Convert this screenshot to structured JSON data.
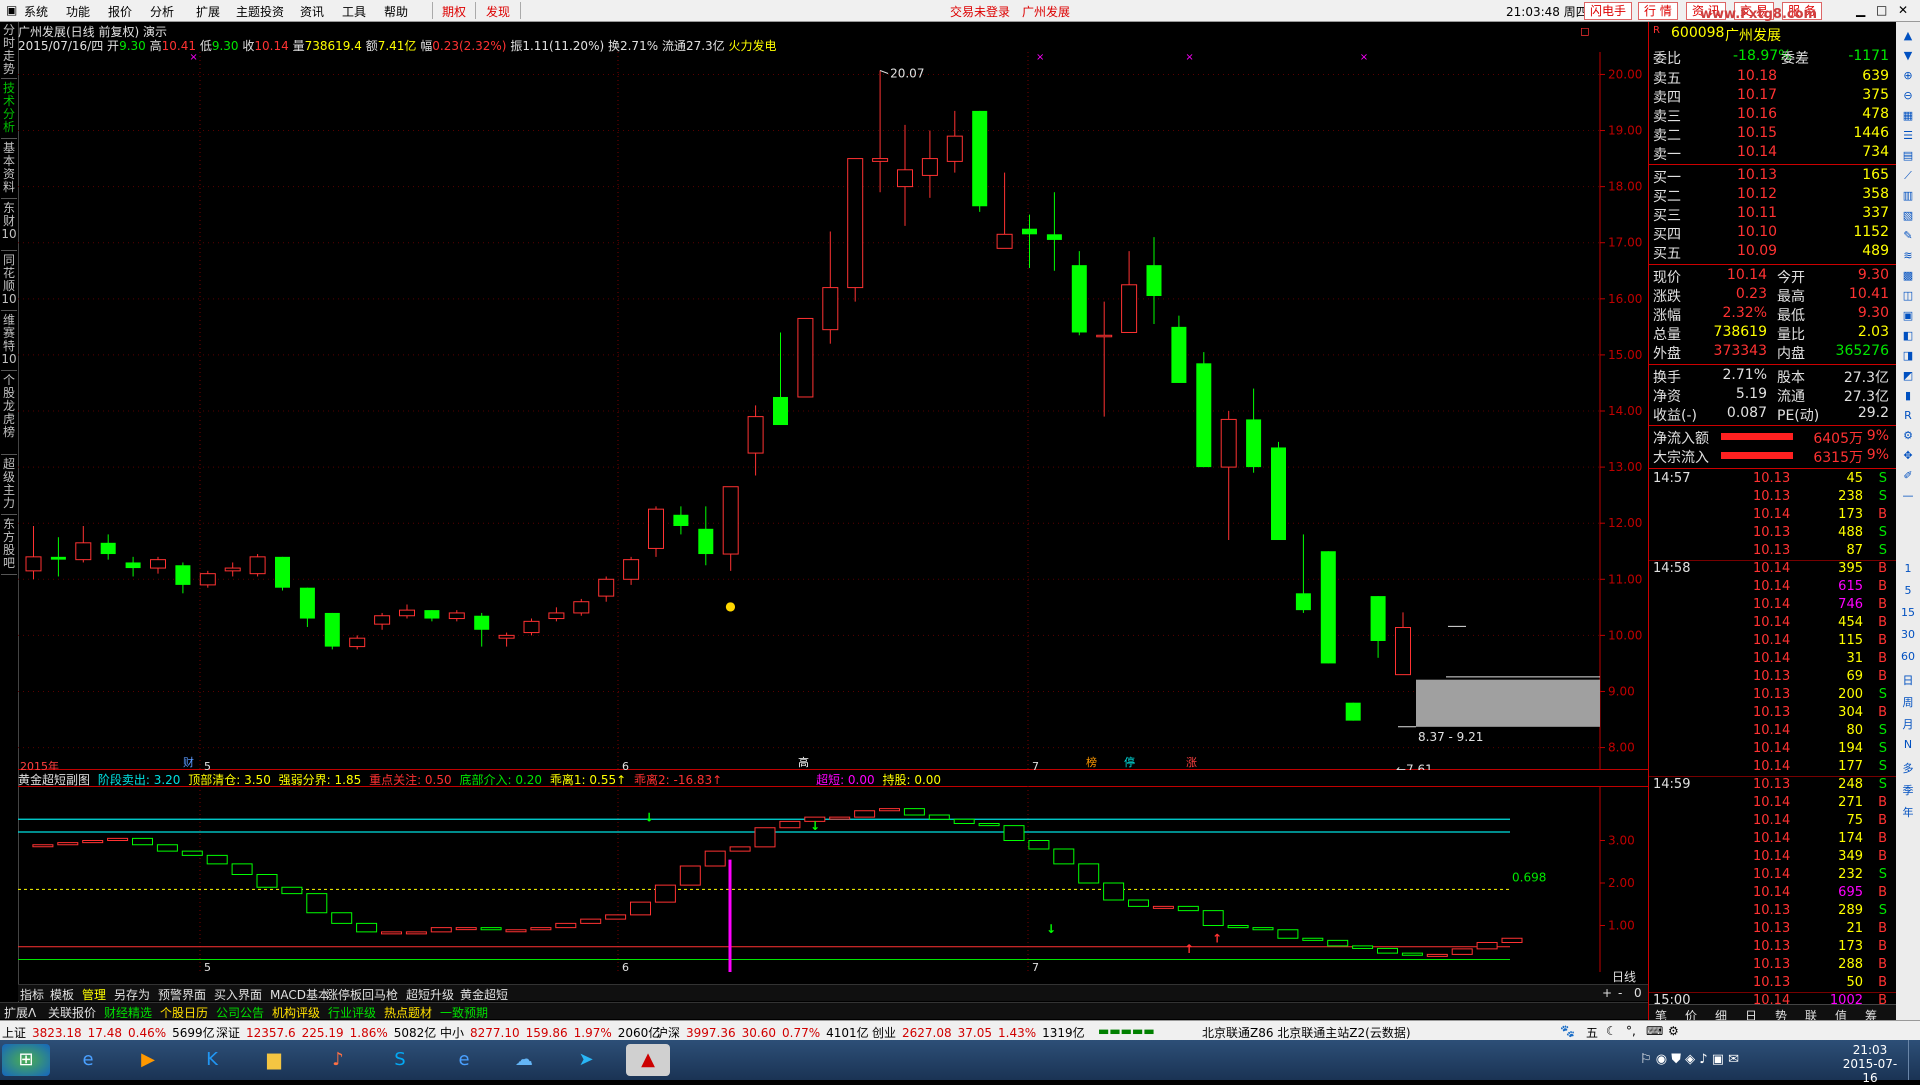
{
  "menu": {
    "items": [
      "系统",
      "功能",
      "报价",
      "分析",
      "扩展",
      "主题投资",
      "资讯",
      "工具",
      "帮助"
    ],
    "tags": [
      "期权",
      "发现"
    ],
    "center_notice": "交易未登录",
    "center_stock": "广州发展",
    "clock": "21:03:48 周四",
    "right_buttons": [
      "闪电手",
      "行",
      "情",
      "资",
      "讯",
      "交",
      "易",
      "服",
      "务"
    ],
    "watermark": "www.Fxtg8.com"
  },
  "left_tabs": [
    "分时走势",
    "技术分析",
    "基本资料",
    "东财10",
    "同花顺10",
    "维赛特10",
    "个股龙虎榜",
    "超级主力",
    "东方股吧"
  ],
  "chart_header": {
    "line1": "广州发展(日线 前复权) 演示",
    "date": "2015/07/16/四",
    "open_label": "开",
    "open": "9.30",
    "high_label": "高",
    "high": "10.41",
    "low_label": "低",
    "low": "9.30",
    "close_label": "收",
    "close": "10.14",
    "vol_label": "量",
    "vol": "738619.4",
    "amt_label": "额",
    "amt": "7.41亿",
    "chg_label": "幅",
    "chg": "0.23(2.32%)",
    "amp": "振1.11(11.20%)",
    "turnover": "换2.71%",
    "float": "流通27.3亿",
    "concept": "火力发电"
  },
  "chart_data": [
    {
      "type": "candlestick",
      "title": "广州发展(日线 前复权) 演示",
      "ylim": [
        7.6,
        20.4
      ],
      "y_ticks": [
        "20.00",
        "19.00",
        "18.00",
        "17.00",
        "16.00",
        "15.00",
        "14.00",
        "13.00",
        "12.00",
        "11.00",
        "10.00",
        "9.00",
        "8.00"
      ],
      "x_labels": [
        "2015年",
        "5",
        "6",
        "7"
      ],
      "annotations": [
        "20.07",
        "7.61",
        "8.37 - 9.21"
      ],
      "candles": [
        {
          "o": 11.15,
          "h": 11.95,
          "l": 11.0,
          "c": 11.4
        },
        {
          "o": 11.4,
          "h": 11.75,
          "l": 11.05,
          "c": 11.35
        },
        {
          "o": 11.35,
          "h": 11.95,
          "l": 11.3,
          "c": 11.65
        },
        {
          "o": 11.65,
          "h": 11.8,
          "l": 11.35,
          "c": 11.45
        },
        {
          "o": 11.3,
          "h": 11.4,
          "l": 11.05,
          "c": 11.2
        },
        {
          "o": 11.2,
          "h": 11.4,
          "l": 11.1,
          "c": 11.35
        },
        {
          "o": 11.25,
          "h": 11.3,
          "l": 10.75,
          "c": 10.9
        },
        {
          "o": 10.9,
          "h": 11.15,
          "l": 10.85,
          "c": 11.1
        },
        {
          "o": 11.15,
          "h": 11.3,
          "l": 11.05,
          "c": 11.2
        },
        {
          "o": 11.1,
          "h": 11.45,
          "l": 11.05,
          "c": 11.4
        },
        {
          "o": 11.4,
          "h": 11.4,
          "l": 10.8,
          "c": 10.85
        },
        {
          "o": 10.85,
          "h": 10.85,
          "l": 10.15,
          "c": 10.3
        },
        {
          "o": 10.4,
          "h": 10.4,
          "l": 9.75,
          "c": 9.8
        },
        {
          "o": 9.8,
          "h": 10.0,
          "l": 9.75,
          "c": 9.95
        },
        {
          "o": 10.2,
          "h": 10.4,
          "l": 10.1,
          "c": 10.35
        },
        {
          "o": 10.35,
          "h": 10.55,
          "l": 10.3,
          "c": 10.45
        },
        {
          "o": 10.45,
          "h": 10.45,
          "l": 10.25,
          "c": 10.3
        },
        {
          "o": 10.3,
          "h": 10.45,
          "l": 10.25,
          "c": 10.4
        },
        {
          "o": 10.35,
          "h": 10.4,
          "l": 9.8,
          "c": 10.1
        },
        {
          "o": 9.95,
          "h": 10.05,
          "l": 9.8,
          "c": 10.0
        },
        {
          "o": 10.05,
          "h": 10.3,
          "l": 10.0,
          "c": 10.25
        },
        {
          "o": 10.3,
          "h": 10.5,
          "l": 10.25,
          "c": 10.4
        },
        {
          "o": 10.4,
          "h": 10.65,
          "l": 10.35,
          "c": 10.6
        },
        {
          "o": 10.7,
          "h": 11.05,
          "l": 10.6,
          "c": 11.0
        },
        {
          "o": 11.0,
          "h": 11.4,
          "l": 10.9,
          "c": 11.35
        },
        {
          "o": 11.55,
          "h": 12.3,
          "l": 11.4,
          "c": 12.25
        },
        {
          "o": 12.15,
          "h": 12.3,
          "l": 11.8,
          "c": 11.95
        },
        {
          "o": 11.9,
          "h": 12.3,
          "l": 11.25,
          "c": 11.45
        },
        {
          "o": 11.45,
          "h": 12.6,
          "l": 11.15,
          "c": 12.65
        },
        {
          "o": 13.25,
          "h": 14.1,
          "l": 12.85,
          "c": 13.9
        },
        {
          "o": 14.25,
          "h": 15.4,
          "l": 13.75,
          "c": 13.75
        },
        {
          "o": 14.25,
          "h": 15.65,
          "l": 14.25,
          "c": 15.65
        },
        {
          "o": 15.45,
          "h": 17.2,
          "l": 15.2,
          "c": 16.2
        },
        {
          "o": 16.2,
          "h": 18.5,
          "l": 15.95,
          "c": 18.5
        },
        {
          "o": 18.45,
          "h": 20.07,
          "l": 17.9,
          "c": 18.5
        },
        {
          "o": 18.0,
          "h": 19.1,
          "l": 17.3,
          "c": 18.3
        },
        {
          "o": 18.2,
          "h": 19.0,
          "l": 17.8,
          "c": 18.5
        },
        {
          "o": 18.45,
          "h": 19.35,
          "l": 18.25,
          "c": 18.9
        },
        {
          "o": 19.35,
          "h": 19.35,
          "l": 17.55,
          "c": 17.65
        },
        {
          "o": 16.9,
          "h": 18.25,
          "l": 16.9,
          "c": 17.15
        },
        {
          "o": 17.25,
          "h": 17.5,
          "l": 16.55,
          "c": 17.15
        },
        {
          "o": 17.15,
          "h": 17.9,
          "l": 16.5,
          "c": 17.05
        },
        {
          "o": 16.6,
          "h": 16.85,
          "l": 15.35,
          "c": 15.4
        },
        {
          "o": 15.35,
          "h": 15.95,
          "l": 13.9,
          "c": 15.35
        },
        {
          "o": 15.4,
          "h": 16.85,
          "l": 15.4,
          "c": 16.25
        },
        {
          "o": 16.6,
          "h": 17.1,
          "l": 15.55,
          "c": 16.05
        },
        {
          "o": 15.5,
          "h": 15.7,
          "l": 14.5,
          "c": 14.5
        },
        {
          "o": 14.85,
          "h": 15.05,
          "l": 13.0,
          "c": 13.0
        },
        {
          "o": 13.0,
          "h": 14.0,
          "l": 11.7,
          "c": 13.85
        },
        {
          "o": 13.85,
          "h": 14.4,
          "l": 12.9,
          "c": 13.0
        },
        {
          "o": 13.35,
          "h": 13.45,
          "l": 11.7,
          "c": 11.7
        },
        {
          "o": 10.75,
          "h": 11.8,
          "l": 10.4,
          "c": 10.45
        },
        {
          "o": 11.5,
          "h": 11.5,
          "l": 9.5,
          "c": 9.5
        },
        {
          "o": 8.8,
          "h": 8.8,
          "l": 8.48,
          "c": 8.48
        },
        {
          "o": 10.7,
          "h": 10.7,
          "l": 9.6,
          "c": 9.9
        },
        {
          "o": 9.3,
          "h": 10.41,
          "l": 9.3,
          "c": 10.14
        }
      ]
    },
    {
      "type": "line",
      "title": "黄金超短副图",
      "ylim": [
        0,
        4
      ],
      "y_ticks": [
        "3.00",
        "2.00",
        "1.00"
      ],
      "annotations": [
        "0.698"
      ],
      "x_labels": [
        "5",
        "6",
        "7"
      ],
      "series": [
        {
          "name": "阶段卖出",
          "values": [
            2.9,
            2.9,
            2.95,
            3.0,
            3.05,
            2.9,
            2.75,
            2.65,
            2.45,
            2.2,
            1.9,
            1.75,
            1.3,
            1.05,
            0.85,
            0.85,
            0.85,
            0.95,
            0.95,
            0.9,
            0.9,
            0.95,
            1.05,
            1.15,
            1.25,
            1.55,
            1.95,
            2.4,
            2.75,
            2.85,
            3.3,
            3.45,
            3.55,
            3.55,
            3.7,
            3.75,
            3.6,
            3.5,
            3.4,
            3.35,
            3.0,
            2.8,
            2.45,
            2.0,
            1.6,
            1.45,
            1.45,
            1.35,
            1.0,
            0.95,
            0.9,
            0.7,
            0.65,
            0.52,
            0.46,
            0.35,
            0.3,
            0.32,
            0.45,
            0.6,
            0.7
          ]
        }
      ]
    }
  ],
  "markers": [
    "财",
    "高",
    "榜",
    "停",
    "涨"
  ],
  "indicator_header": {
    "name": "黄金超短副图",
    "items": [
      {
        "label": "阶段卖出: ",
        "value": "3.20"
      },
      {
        "label": "顶部清仓: ",
        "value": "3.50"
      },
      {
        "label": "强弱分界: ",
        "value": "1.85"
      },
      {
        "label": "重点关注: ",
        "value": "0.50"
      },
      {
        "label": "底部介入: ",
        "value": "0.20"
      },
      {
        "label": "乖离1: ",
        "value": "0.55↑"
      },
      {
        "label": "乖离2: ",
        "value": "-16.83↑"
      },
      {
        "label": "超短: ",
        "value": "0.00"
      },
      {
        "label": "持股: ",
        "value": "0.00"
      }
    ]
  },
  "period_label": "日线",
  "bottom_tabs1": [
    "指标",
    "模板",
    "管理",
    "另存为",
    "预警界面",
    "买入界面",
    "MACD基本",
    "涨停板回马枪",
    "超短升级",
    "黄金超短"
  ],
  "bottom_tabs2": [
    "扩展Λ",
    "关联报价",
    "财经精选",
    "个股日历",
    "公司公告",
    "机构评级",
    "行业评级",
    "热点题材",
    "一致预期"
  ],
  "quote": {
    "code": "600098",
    "name": "广州发展",
    "weibi_label": "委比",
    "weibi": "-18.97%",
    "weicha_label": "委差",
    "weicha": "-1171",
    "asks": [
      {
        "label": "卖五",
        "price": "10.18",
        "vol": "639"
      },
      {
        "label": "卖四",
        "price": "10.17",
        "vol": "375"
      },
      {
        "label": "卖三",
        "price": "10.16",
        "vol": "478"
      },
      {
        "label": "卖二",
        "price": "10.15",
        "vol": "1446"
      },
      {
        "label": "卖一",
        "price": "10.14",
        "vol": "734"
      }
    ],
    "bids": [
      {
        "label": "买一",
        "price": "10.13",
        "vol": "165"
      },
      {
        "label": "买二",
        "price": "10.12",
        "vol": "358"
      },
      {
        "label": "买三",
        "price": "10.11",
        "vol": "337"
      },
      {
        "label": "买四",
        "price": "10.10",
        "vol": "1152"
      },
      {
        "label": "买五",
        "price": "10.09",
        "vol": "489"
      }
    ],
    "stats": [
      {
        "l1": "现价",
        "v1": "10.14",
        "l2": "今开",
        "v2": "9.30"
      },
      {
        "l1": "涨跌",
        "v1": "0.23",
        "l2": "最高",
        "v2": "10.41"
      },
      {
        "l1": "涨幅",
        "v1": "2.32%",
        "l2": "最低",
        "v2": "9.30"
      },
      {
        "l1": "总量",
        "v1": "738619",
        "l2": "量比",
        "v2": "2.03"
      },
      {
        "l1": "外盘",
        "v1": "373343",
        "l2": "内盘",
        "v2": "365276"
      }
    ],
    "stats2": [
      {
        "l1": "换手",
        "v1": "2.71%",
        "l2": "股本",
        "v2": "27.3亿"
      },
      {
        "l1": "净资",
        "v1": "5.19",
        "l2": "流通",
        "v2": "27.3亿"
      },
      {
        "l1": "收益(-)",
        "v1": "0.087",
        "l2": "PE(动)",
        "v2": "29.2"
      }
    ],
    "flows": [
      {
        "label": "净流入额",
        "value": "6405万",
        "pct": "9%"
      },
      {
        "label": "大宗流入",
        "value": "6315万",
        "pct": "9%"
      }
    ]
  },
  "ticks": [
    {
      "time": "14:57",
      "price": "10.13",
      "vol": "45",
      "side": "S"
    },
    {
      "time": "",
      "price": "10.13",
      "vol": "238",
      "side": "S"
    },
    {
      "time": "",
      "price": "10.14",
      "vol": "173",
      "side": "B"
    },
    {
      "time": "",
      "price": "10.13",
      "vol": "488",
      "side": "S"
    },
    {
      "time": "",
      "price": "10.13",
      "vol": "87",
      "side": "S"
    },
    {
      "time": "14:58",
      "price": "10.14",
      "vol": "395",
      "side": "B"
    },
    {
      "time": "",
      "price": "10.14",
      "vol": "615",
      "side": "B"
    },
    {
      "time": "",
      "price": "10.14",
      "vol": "746",
      "side": "B"
    },
    {
      "time": "",
      "price": "10.14",
      "vol": "454",
      "side": "B"
    },
    {
      "time": "",
      "price": "10.14",
      "vol": "115",
      "side": "B"
    },
    {
      "time": "",
      "price": "10.14",
      "vol": "31",
      "side": "B"
    },
    {
      "time": "",
      "price": "10.13",
      "vol": "69",
      "side": "B"
    },
    {
      "time": "",
      "price": "10.13",
      "vol": "200",
      "side": "S"
    },
    {
      "time": "",
      "price": "10.13",
      "vol": "304",
      "side": "B"
    },
    {
      "time": "",
      "price": "10.14",
      "vol": "80",
      "side": "S"
    },
    {
      "time": "",
      "price": "10.14",
      "vol": "194",
      "side": "S"
    },
    {
      "time": "",
      "price": "10.14",
      "vol": "177",
      "side": "S"
    },
    {
      "time": "14:59",
      "price": "10.13",
      "vol": "248",
      "side": "S"
    },
    {
      "time": "",
      "price": "10.14",
      "vol": "271",
      "side": "B"
    },
    {
      "time": "",
      "price": "10.14",
      "vol": "75",
      "side": "B"
    },
    {
      "time": "",
      "price": "10.14",
      "vol": "174",
      "side": "B"
    },
    {
      "time": "",
      "price": "10.14",
      "vol": "349",
      "side": "B"
    },
    {
      "time": "",
      "price": "10.14",
      "vol": "232",
      "side": "S"
    },
    {
      "time": "",
      "price": "10.14",
      "vol": "695",
      "side": "B"
    },
    {
      "time": "",
      "price": "10.13",
      "vol": "289",
      "side": "S"
    },
    {
      "time": "",
      "price": "10.13",
      "vol": "21",
      "side": "B"
    },
    {
      "time": "",
      "price": "10.13",
      "vol": "173",
      "side": "B"
    },
    {
      "time": "",
      "price": "10.13",
      "vol": "288",
      "side": "B"
    },
    {
      "time": "",
      "price": "10.13",
      "vol": "50",
      "side": "B"
    },
    {
      "time": "15:00",
      "price": "10.14",
      "vol": "1002",
      "side": "B"
    }
  ],
  "right_bottom_tabs": [
    "笔",
    "价",
    "细",
    "日",
    "势",
    "联",
    "值",
    "筹"
  ],
  "right_toolbar": [
    "1",
    "5",
    "15",
    "30",
    "60",
    "日",
    "周",
    "月",
    "N",
    "多",
    "季",
    "年"
  ],
  "status": [
    {
      "label": "上证",
      "value": "3823.18",
      "chg": "17.48",
      "pct": "0.46%",
      "amt": "5699亿"
    },
    {
      "label": "深证",
      "value": "12357.6",
      "chg": "225.19",
      "pct": "1.86%",
      "amt": "5082亿"
    },
    {
      "label": "中小",
      "value": "8277.10",
      "chg": "159.86",
      "pct": "1.97%",
      "amt": "2060亿"
    },
    {
      "label": "沪深",
      "value": "3997.36",
      "chg": "30.60",
      "pct": "0.77%",
      "amt": "4101亿"
    },
    {
      "label": "创业",
      "value": "2627.08",
      "chg": "37.05",
      "pct": "1.43%",
      "amt": "1319亿"
    }
  ],
  "server": "北京联通Z86  北京联通主站Z2(云数据)",
  "taskbar": {
    "time": "21:03",
    "date": "2015-07-16"
  },
  "colors": {
    "up": "#ff3232",
    "down": "#00ff00",
    "axis": "#ff0000",
    "bg": "#000000"
  }
}
